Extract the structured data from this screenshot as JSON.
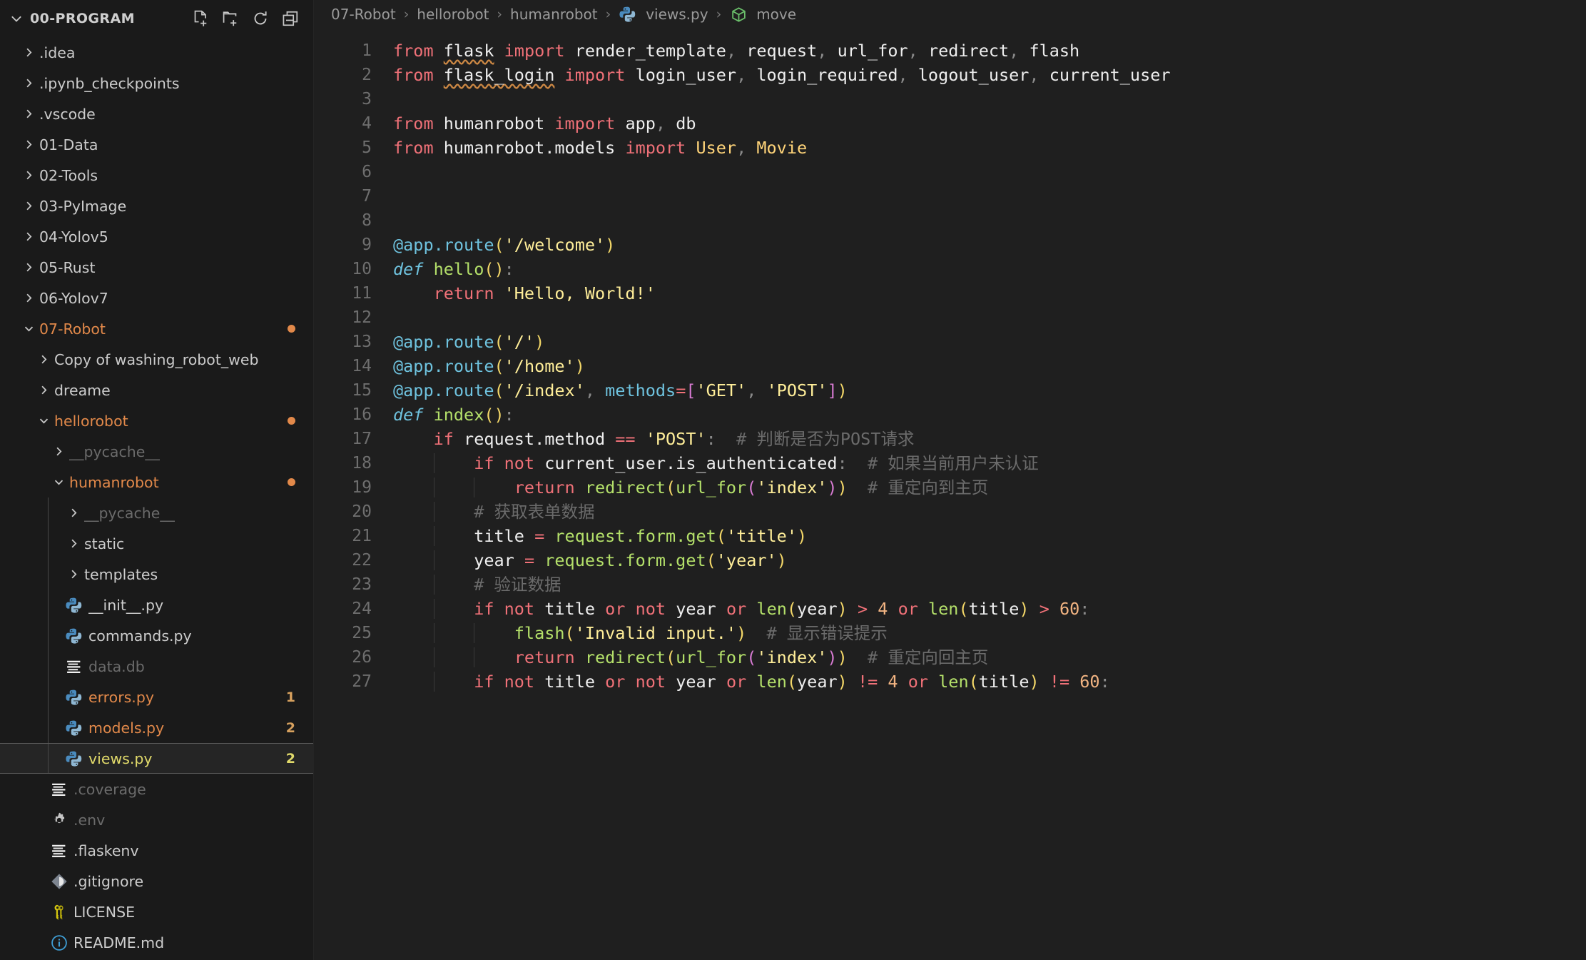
{
  "sidebar": {
    "header": {
      "title": "00-PROGRAM",
      "actions": [
        {
          "name": "new-file-icon",
          "label": "New File"
        },
        {
          "name": "new-folder-icon",
          "label": "New Folder"
        },
        {
          "name": "refresh-icon",
          "label": "Refresh Explorer"
        },
        {
          "name": "collapse-all-icon",
          "label": "Collapse Folders in Explorer"
        }
      ]
    },
    "tree": [
      {
        "label": ".idea",
        "type": "folder",
        "state": "collapsed",
        "depth": 1,
        "color": "#cccccc"
      },
      {
        "label": ".ipynb_checkpoints",
        "type": "folder",
        "state": "collapsed",
        "depth": 1,
        "color": "#cccccc"
      },
      {
        "label": ".vscode",
        "type": "folder",
        "state": "collapsed",
        "depth": 1,
        "color": "#cccccc"
      },
      {
        "label": "01-Data",
        "type": "folder",
        "state": "collapsed",
        "depth": 1,
        "color": "#cccccc"
      },
      {
        "label": "02-Tools",
        "type": "folder",
        "state": "collapsed",
        "depth": 1,
        "color": "#cccccc"
      },
      {
        "label": "03-PyImage",
        "type": "folder",
        "state": "collapsed",
        "depth": 1,
        "color": "#cccccc"
      },
      {
        "label": "04-Yolov5",
        "type": "folder",
        "state": "collapsed",
        "depth": 1,
        "color": "#cccccc"
      },
      {
        "label": "05-Rust",
        "type": "folder",
        "state": "collapsed",
        "depth": 1,
        "color": "#cccccc"
      },
      {
        "label": "06-Yolov7",
        "type": "folder",
        "state": "collapsed",
        "depth": 1,
        "color": "#cccccc"
      },
      {
        "label": "07-Robot",
        "type": "folder",
        "state": "expanded",
        "depth": 1,
        "color": "#e2894a",
        "dot": "#e2894a"
      },
      {
        "label": "Copy of washing_robot_web",
        "type": "folder",
        "state": "collapsed",
        "depth": 2,
        "color": "#cccccc"
      },
      {
        "label": "dreame",
        "type": "folder",
        "state": "collapsed",
        "depth": 2,
        "color": "#cccccc"
      },
      {
        "label": "hellorobot",
        "type": "folder",
        "state": "expanded",
        "depth": 2,
        "color": "#e2894a",
        "dot": "#e2894a"
      },
      {
        "label": "__pycache__",
        "type": "folder",
        "state": "collapsed",
        "depth": 3,
        "color": "#6b6b6b"
      },
      {
        "label": "humanrobot",
        "type": "folder",
        "state": "expanded",
        "depth": 3,
        "color": "#e2894a",
        "dot": "#e2894a"
      },
      {
        "label": "__pycache__",
        "type": "folder",
        "state": "collapsed",
        "depth": 4,
        "color": "#6b6b6b",
        "guide": true
      },
      {
        "label": "static",
        "type": "folder",
        "state": "collapsed",
        "depth": 4,
        "color": "#cccccc",
        "guide": true
      },
      {
        "label": "templates",
        "type": "folder",
        "state": "collapsed",
        "depth": 4,
        "color": "#cccccc",
        "guide": true
      },
      {
        "label": "__init__.py",
        "type": "python",
        "depth": 4,
        "color": "#cccccc",
        "guide": true
      },
      {
        "label": "commands.py",
        "type": "python",
        "depth": 4,
        "color": "#cccccc",
        "guide": true
      },
      {
        "label": "data.db",
        "type": "database",
        "depth": 4,
        "color": "#6b6b6b",
        "guide": true
      },
      {
        "label": "errors.py",
        "type": "python",
        "depth": 4,
        "color": "#e2894a",
        "badge": "1",
        "badgeColor": "#d7a15e",
        "guide": true
      },
      {
        "label": "models.py",
        "type": "python",
        "depth": 4,
        "color": "#e2894a",
        "badge": "2",
        "badgeColor": "#d7a15e",
        "guide": true
      },
      {
        "label": "views.py",
        "type": "python",
        "depth": 4,
        "color": "#e0d96a",
        "badge": "2",
        "badgeColor": "#e0d96a",
        "selected": true,
        "guide": true
      },
      {
        "label": ".coverage",
        "type": "text",
        "depth": 3,
        "color": "#6b6b6b"
      },
      {
        "label": ".env",
        "type": "gear",
        "depth": 3,
        "color": "#6b6b6b"
      },
      {
        "label": ".flaskenv",
        "type": "text",
        "depth": 3,
        "color": "#cccccc"
      },
      {
        "label": ".gitignore",
        "type": "git",
        "depth": 3,
        "color": "#cccccc"
      },
      {
        "label": "LICENSE",
        "type": "license",
        "depth": 3,
        "color": "#cccccc"
      },
      {
        "label": "README.md",
        "type": "readme",
        "depth": 3,
        "color": "#cccccc"
      }
    ]
  },
  "breadcrumbs": {
    "items": [
      {
        "label": "07-Robot",
        "icon": null
      },
      {
        "label": "hellorobot",
        "icon": null
      },
      {
        "label": "humanrobot",
        "icon": null
      },
      {
        "label": "views.py",
        "icon": "python-icon"
      },
      {
        "label": "move",
        "icon": "symbol-method-icon"
      }
    ],
    "separator": "›"
  },
  "editor": {
    "language": "Python",
    "file": "views.py",
    "first_line": 1,
    "line_numbers": [
      1,
      2,
      3,
      4,
      5,
      6,
      7,
      8,
      9,
      10,
      11,
      12,
      13,
      14,
      15,
      16,
      17,
      18,
      19,
      20,
      21,
      22,
      23,
      24,
      25,
      26,
      27
    ],
    "lines": [
      "from flask import render_template, request, url_for, redirect, flash",
      "from flask_login import login_user, login_required, logout_user, current_user",
      "",
      "from humanrobot import app, db",
      "from humanrobot.models import User, Movie",
      "",
      "",
      "",
      "@app.route('/welcome')",
      "def hello():",
      "    return 'Hello, World!'",
      "",
      "@app.route('/')",
      "@app.route('/home')",
      "@app.route('/index', methods=['GET', 'POST'])",
      "def index():",
      "    if request.method == 'POST':  # 判断是否为POST请求",
      "        if not current_user.is_authenticated:  # 如果当前用户未认证",
      "            return redirect(url_for('index'))  # 重定向到主页",
      "        # 获取表单数据",
      "        title = request.form.get('title')",
      "        year = request.form.get('year')",
      "        # 验证数据",
      "        if not title or not year or len(year) > 4 or len(title) > 60:",
      "            flash('Invalid input.')  # 显示错误提示",
      "            return redirect(url_for('index'))  # 重定向回主页",
      "        if not title or not year or len(year) != 4 or len(title) != 60:"
    ]
  },
  "colors": {
    "editor_background": "#1f1f1f",
    "sidebar_background": "#1a1a1a",
    "keyword": "#f07178",
    "string": "#ffee99",
    "decorator": "#6fc3df",
    "function": "#b4e06a",
    "comment": "#6b6b6b",
    "modified": "#e2894a",
    "selected_file": "#e0d96a"
  }
}
